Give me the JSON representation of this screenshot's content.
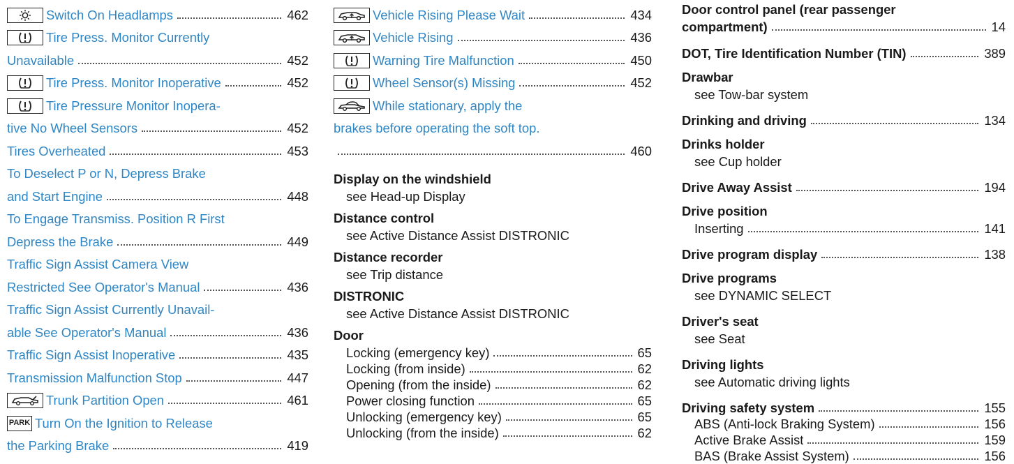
{
  "col1": [
    {
      "icon": "sun",
      "text": "Switch On Headlamps",
      "page": "462"
    },
    {
      "icon": "tire",
      "text": "Tire Press. Monitor Currently"
    },
    {
      "text": "Unavailable",
      "page": "452"
    },
    {
      "icon": "tire",
      "text": "Tire Press. Monitor Inoperative",
      "page": "452"
    },
    {
      "icon": "tire",
      "text": "Tire Pressure Monitor Inopera-"
    },
    {
      "text": "tive No Wheel Sensors",
      "page": "452"
    },
    {
      "text": "Tires Overheated",
      "page": "453"
    },
    {
      "text": "To Deselect P or N, Depress Brake"
    },
    {
      "text": "and Start Engine",
      "page": "448"
    },
    {
      "text": "To Engage Transmiss. Position R First"
    },
    {
      "text": "Depress the Brake",
      "page": "449"
    },
    {
      "text": "Traffic Sign Assist Camera View"
    },
    {
      "text": "Restricted See Operator's Manual",
      "page": "436"
    },
    {
      "text": "Traffic Sign Assist Currently Unavail-"
    },
    {
      "text": "able See Operator's Manual",
      "page": "436"
    },
    {
      "text": "Traffic Sign Assist Inoperative",
      "page": "435"
    },
    {
      "text": "Transmission Malfunction Stop",
      "page": "447"
    },
    {
      "icon": "trunk",
      "text": "Trunk Partition Open",
      "page": "461"
    },
    {
      "icon": "park",
      "icon_text": "PARK",
      "text": "Turn On the Ignition to Release"
    },
    {
      "text": "the Parking Brake",
      "page": "419"
    }
  ],
  "col2_top": [
    {
      "icon": "car",
      "text": "Vehicle Rising Please Wait",
      "page": "434"
    },
    {
      "icon": "car",
      "text": "Vehicle Rising",
      "page": "436"
    },
    {
      "icon": "tire",
      "text": "Warning Tire Malfunction",
      "page": "450"
    },
    {
      "icon": "tire",
      "text": "Wheel Sensor(s) Missing",
      "page": "452"
    },
    {
      "icon": "softtop",
      "text": "While stationary, apply the"
    },
    {
      "text": "brakes before operating the soft top."
    },
    {
      "text": "",
      "page": "460"
    }
  ],
  "col2_entries": [
    {
      "head": "Display on the windshield",
      "see": "see Head-up Display"
    },
    {
      "head": "Distance control",
      "see": "see Active Distance Assist DISTRONIC"
    },
    {
      "head": "Distance recorder",
      "see": "see Trip distance"
    },
    {
      "head": "DISTRONIC",
      "see": "see Active Distance Assist DISTRONIC"
    },
    {
      "head": "Door",
      "subs": [
        {
          "text": "Locking (emergency key)",
          "page": "65"
        },
        {
          "text": "Locking (from inside)",
          "page": "62"
        },
        {
          "text": "Opening (from the inside)",
          "page": "62"
        },
        {
          "text": "Power closing function",
          "page": "65"
        },
        {
          "text": "Unlocking (emergency key)",
          "page": "65"
        },
        {
          "text": "Unlocking (from the inside)",
          "page": "62"
        }
      ]
    }
  ],
  "col3": {
    "door_panel_1": "Door control panel (rear passenger",
    "door_panel_2": "compartment)",
    "door_panel_page": "14",
    "dot": "DOT, Tire Identification Number (TIN)",
    "dot_page": "389",
    "drawbar": "Drawbar",
    "drawbar_see": "see Tow-bar system",
    "drinking": "Drinking and driving",
    "drinking_page": "134",
    "drinks": "Drinks holder",
    "drinks_see": "see Cup holder",
    "drive_away": "Drive Away Assist",
    "drive_away_page": "194",
    "drive_pos": "Drive position",
    "inserting": "Inserting",
    "inserting_page": "141",
    "drive_prog_disp": "Drive program display",
    "drive_prog_disp_page": "138",
    "drive_progs": "Drive programs",
    "drive_progs_see": "see DYNAMIC SELECT",
    "drivers_seat": "Driver's seat",
    "drivers_seat_see": "see Seat",
    "driving_lights": "Driving lights",
    "driving_lights_see": "see Automatic driving lights",
    "safety": "Driving safety system",
    "safety_page": "155",
    "abs": "ABS (Anti-lock Braking System)",
    "abs_page": "156",
    "aba": "Active Brake Assist",
    "aba_page": "159",
    "bas": "BAS (Brake Assist System)",
    "bas_page": "156"
  }
}
